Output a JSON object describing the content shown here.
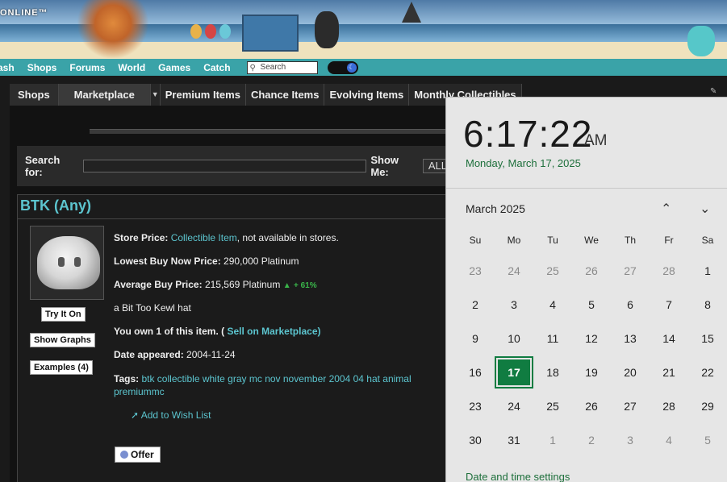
{
  "banner": {
    "logo_text": "ONLINE™"
  },
  "nav": {
    "items": [
      "ash",
      "Shops",
      "Forums",
      "World",
      "Games",
      "Catch"
    ],
    "search_placeholder": "Search"
  },
  "tabs": {
    "shops": "Shops",
    "marketplace": "Marketplace",
    "premium": "Premium Items",
    "chance": "Chance Items",
    "evolving": "Evolving Items",
    "monthly": "Monthly Collectibles"
  },
  "search": {
    "label": "Search for:",
    "show_me_label": "Show Me:",
    "show_me_value": "ALL"
  },
  "item": {
    "title": "BTK (Any)",
    "buttons": {
      "try_it_on": "Try It On",
      "show_graphs": "Show Graphs",
      "examples": "Examples (4)"
    },
    "store_price_label": "Store Price:",
    "store_price_link": "Collectible Item",
    "store_price_suffix": ", not available in stores.",
    "lowest_label": "Lowest Buy Now Price:",
    "lowest_value": "290,000 Platinum",
    "average_label": "Average Buy Price:",
    "average_value": "215,569 Platinum",
    "average_change": "+ 61%",
    "description": "a Bit Too Kewl hat",
    "own_text": "You own 1 of this item. (",
    "own_link": "Sell on Marketplace)",
    "date_label": "Date appeared:",
    "date_value": "2004-11-24",
    "tags_label": "Tags:",
    "tags_value": "btk collectible white gray mc nov november 2004 04 hat animal premiummc",
    "wish_list": "Add to Wish List",
    "offer": "Offer"
  },
  "flyout": {
    "time": "6:17:22",
    "ampm": "AM",
    "long_date": "Monday, March 17, 2025",
    "month_label": "March 2025",
    "weekdays": [
      "Su",
      "Mo",
      "Tu",
      "We",
      "Th",
      "Fr",
      "Sa"
    ],
    "weeks": [
      [
        "23",
        "24",
        "25",
        "26",
        "27",
        "28",
        "1"
      ],
      [
        "2",
        "3",
        "4",
        "5",
        "6",
        "7",
        "8"
      ],
      [
        "9",
        "10",
        "11",
        "12",
        "13",
        "14",
        "15"
      ],
      [
        "16",
        "17",
        "18",
        "19",
        "20",
        "21",
        "22"
      ],
      [
        "23",
        "24",
        "25",
        "26",
        "27",
        "28",
        "29"
      ],
      [
        "30",
        "31",
        "1",
        "2",
        "3",
        "4",
        "5"
      ]
    ],
    "today": "17",
    "settings_link": "Date and time settings"
  },
  "colors": {
    "accent_teal": "#3aa3a8",
    "link_cyan": "#5cc5cf",
    "today_green": "#107c41"
  },
  "icons": {
    "search": "search-icon",
    "pin": "pin-icon",
    "moon": "moon-icon",
    "chevron_up": "chevron-up-icon",
    "chevron_down": "chevron-down-icon"
  }
}
